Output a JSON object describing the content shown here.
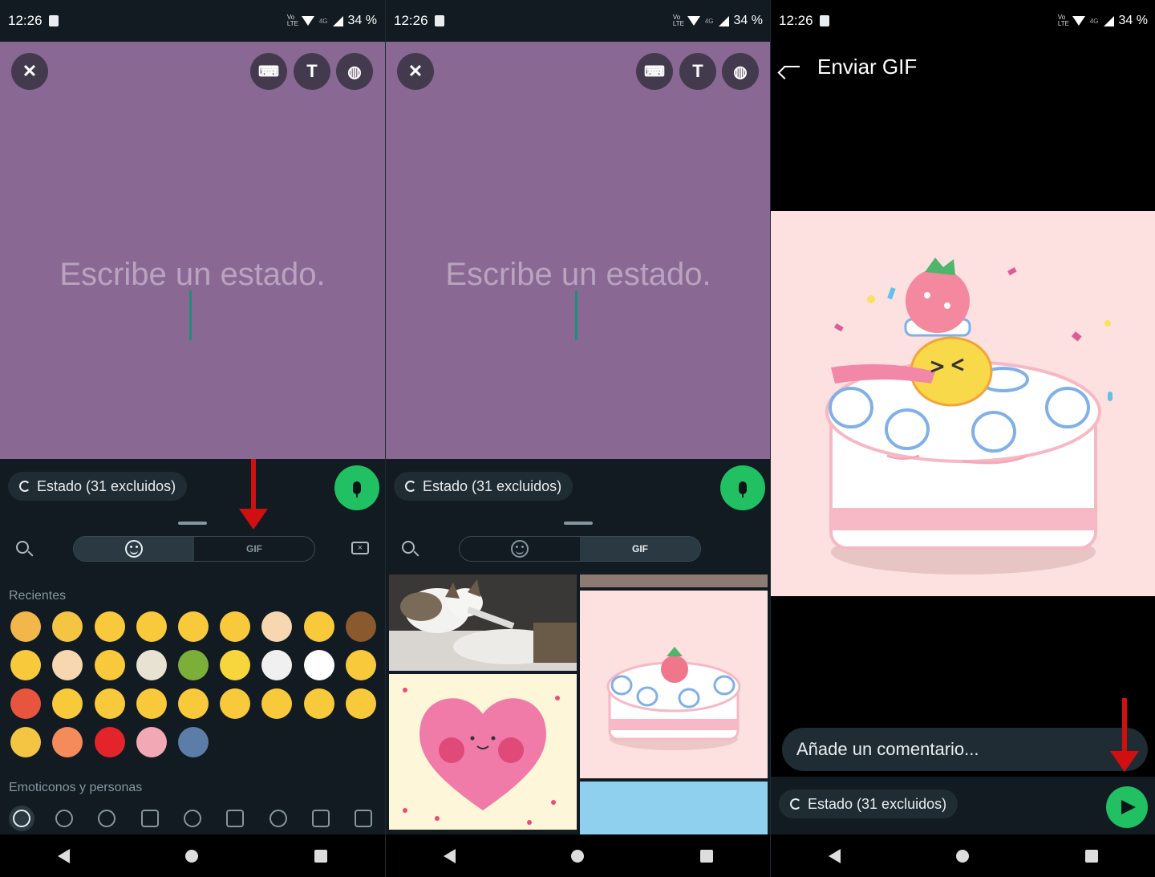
{
  "status_bar": {
    "time": "12:26",
    "network": "4G",
    "battery": "34 %",
    "volte": "Vo LTE"
  },
  "status_editor": {
    "placeholder": "Escribe un estado.",
    "audience_chip": "Estado (31 excluidos)",
    "canvas_color": "#8a6894"
  },
  "keyboard": {
    "gif_tab_label": "GIF",
    "recent_label": "Recientes",
    "category_label": "Emoticonos y personas",
    "emojis": [
      "handshake",
      "thumbs-up",
      "grin-sweat",
      "tongue-out",
      "sad-relieved",
      "rolling-laughing",
      "thumbs-up-light",
      "hand-over-mouth",
      "raised-hands",
      "upside-down",
      "pray",
      "joy",
      "old-man",
      "turtle",
      "banana",
      "skull-crossbones",
      "clown",
      "disappointed",
      "hot-face",
      "blush",
      "open-mouth",
      "relieved",
      "partying",
      "slight-smile",
      "smiling-hearts",
      "relieved-2",
      "raised-eyebrow",
      "thumbs-down",
      "peach",
      "red-heart",
      "brain",
      "technologist"
    ]
  },
  "send_gif": {
    "title": "Enviar GIF",
    "comment_placeholder": "Añade un comentario...",
    "audience_chip": "Estado (31 excluidos)"
  },
  "colors": {
    "accent_green": "#21c063",
    "arrow_red": "#d01010",
    "dark_bg": "#111b21"
  }
}
